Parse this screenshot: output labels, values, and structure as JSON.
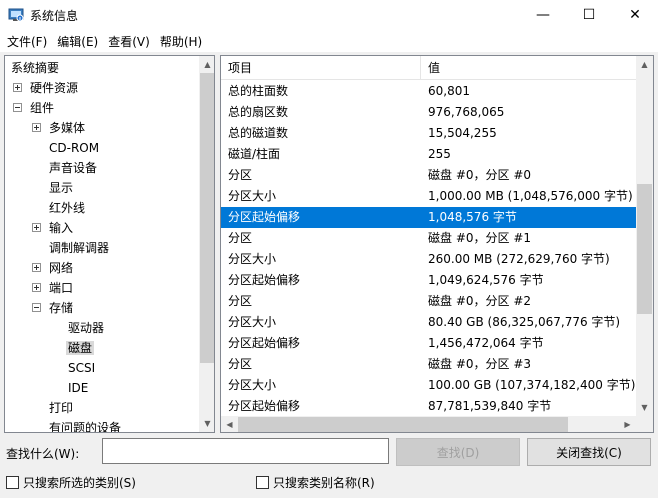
{
  "window": {
    "title": "系统信息",
    "controls": {
      "minimize": "—",
      "maximize": "☐",
      "close": "✕"
    }
  },
  "menu": [
    "文件(F)",
    "编辑(E)",
    "查看(V)",
    "帮助(H)"
  ],
  "tree": {
    "items": [
      {
        "label": "系统摘要",
        "level": 0
      },
      {
        "label": "硬件资源",
        "level": 1,
        "expander": "plus"
      },
      {
        "label": "组件",
        "level": 1,
        "expander": "minus"
      },
      {
        "label": "多媒体",
        "level": 2,
        "expander": "plus"
      },
      {
        "label": "CD-ROM",
        "level": 2
      },
      {
        "label": "声音设备",
        "level": 2
      },
      {
        "label": "显示",
        "level": 2
      },
      {
        "label": "红外线",
        "level": 2
      },
      {
        "label": "输入",
        "level": 2,
        "expander": "plus"
      },
      {
        "label": "调制解调器",
        "level": 2
      },
      {
        "label": "网络",
        "level": 2,
        "expander": "plus"
      },
      {
        "label": "端口",
        "level": 2,
        "expander": "plus"
      },
      {
        "label": "存储",
        "level": 2,
        "expander": "minus"
      },
      {
        "label": "驱动器",
        "level": 3
      },
      {
        "label": "磁盘",
        "level": 3,
        "selected": true
      },
      {
        "label": "SCSI",
        "level": 3
      },
      {
        "label": "IDE",
        "level": 3
      },
      {
        "label": "打印",
        "level": 2
      },
      {
        "label": "有问题的设备",
        "level": 2
      }
    ]
  },
  "list": {
    "headers": [
      "项目",
      "值"
    ],
    "rows": [
      [
        "总的柱面数",
        "60,801"
      ],
      [
        "总的扇区数",
        "976,768,065"
      ],
      [
        "总的磁道数",
        "15,504,255"
      ],
      [
        "磁道/柱面",
        "255"
      ],
      [
        "分区",
        "磁盘 #0，分区 #0"
      ],
      [
        "分区大小",
        "1,000.00 MB (1,048,576,000 字节)"
      ],
      [
        "分区起始偏移",
        "1,048,576 字节"
      ],
      [
        "分区",
        "磁盘 #0，分区 #1"
      ],
      [
        "分区大小",
        "260.00 MB (272,629,760 字节)"
      ],
      [
        "分区起始偏移",
        "1,049,624,576 字节"
      ],
      [
        "分区",
        "磁盘 #0，分区 #2"
      ],
      [
        "分区大小",
        "80.40 GB (86,325,067,776 字节)"
      ],
      [
        "分区起始偏移",
        "1,456,472,064 字节"
      ],
      [
        "分区",
        "磁盘 #0，分区 #3"
      ],
      [
        "分区大小",
        "100.00 GB (107,374,182,400 字节)"
      ],
      [
        "分区起始偏移",
        "87,781,539,840 字节"
      ]
    ],
    "selected_row": 6
  },
  "find": {
    "label": "查找什么(W):",
    "value": "",
    "find_button": "查找(D)",
    "close_button": "关闭查找(C)",
    "option_selected_category": "只搜索所选的类别(S)",
    "option_category_names": "只搜索类别名称(R)"
  },
  "colors": {
    "selection": "#0078d7",
    "tree_selection": "#d9d9d9"
  }
}
